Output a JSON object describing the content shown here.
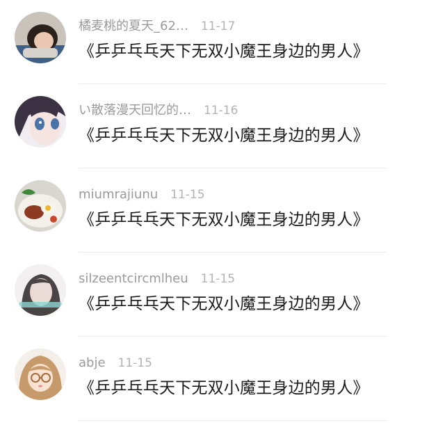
{
  "comments": [
    {
      "username": "橘麦桃的夏天_62…",
      "date": "11-17",
      "content": "《乒乒乓乓天下无双小魔王身边的男人》",
      "avatar_icon": "girl-photo-avatar"
    },
    {
      "username": "い散落漫天回忆的…",
      "date": "11-16",
      "content": "《乒乒乓乓天下无双小魔王身边的男人》",
      "avatar_icon": "anime-girl-avatar"
    },
    {
      "username": "miumrajiunu",
      "date": "11-15",
      "content": "《乒乒乓乓天下无双小魔王身边的男人》",
      "avatar_icon": "food-plate-avatar"
    },
    {
      "username": "silzeentcircmlheu",
      "date": "11-15",
      "content": "《乒乒乓乓天下无双小魔王身边的男人》",
      "avatar_icon": "girl-portrait-avatar"
    },
    {
      "username": "abje",
      "date": "11-15",
      "content": "《乒乒乓乓天下无双小魔王身边的男人》",
      "avatar_icon": "cartoon-girl-glasses-avatar"
    }
  ]
}
